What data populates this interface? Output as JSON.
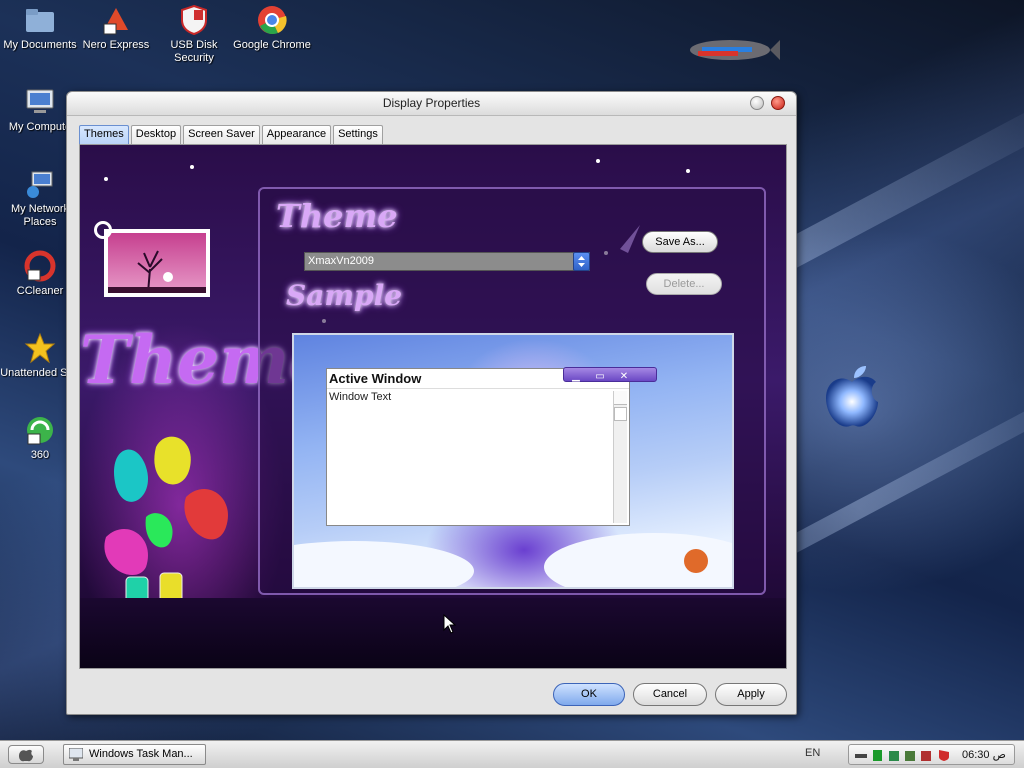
{
  "desktop": {
    "icons": [
      {
        "label": "My Documents"
      },
      {
        "label": "Nero Express"
      },
      {
        "label": "USB Disk Security"
      },
      {
        "label": "Google Chrome"
      },
      {
        "label": "My Compute"
      },
      {
        "label": "My Network Places"
      },
      {
        "label": "CCleaner"
      },
      {
        "label": "Unattended Soft"
      },
      {
        "label": "360"
      }
    ]
  },
  "window": {
    "title": "Display Properties",
    "tabs": [
      {
        "label": "Themes"
      },
      {
        "label": "Desktop"
      },
      {
        "label": "Screen Saver"
      },
      {
        "label": "Appearance"
      },
      {
        "label": "Settings"
      }
    ],
    "themes_panel": {
      "banner_text": "Themes",
      "theme_heading": "Theme",
      "sample_heading": "Sample",
      "theme_select_value": "XmaxVn2009",
      "save_as_label": "Save As...",
      "delete_label": "Delete...",
      "sample": {
        "active_window_title": "Active Window",
        "window_text": "Window Text"
      }
    },
    "buttons": {
      "ok": "OK",
      "cancel": "Cancel",
      "apply": "Apply"
    }
  },
  "taskbar": {
    "task_button_label": "Windows Task Man...",
    "language": "EN",
    "clock": "06:30 ص"
  }
}
